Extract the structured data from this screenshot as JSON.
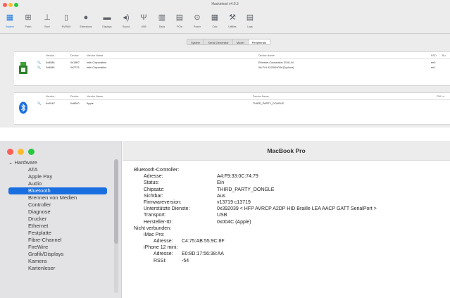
{
  "top_window": {
    "title": "Hackintool v4.0.3",
    "toolbar": [
      {
        "label": "System",
        "icon": "system-icon"
      },
      {
        "label": "Patch",
        "icon": "patch-icon"
      },
      {
        "label": "Boot",
        "icon": "boot-icon"
      },
      {
        "label": "NVRAM",
        "icon": "nvram-icon"
      },
      {
        "label": "Extensions",
        "icon": "extensions-icon"
      },
      {
        "label": "Displays",
        "icon": "displays-icon"
      },
      {
        "label": "Sound",
        "icon": "sound-icon"
      },
      {
        "label": "USB",
        "icon": "usb-icon"
      },
      {
        "label": "Disks",
        "icon": "disks-icon"
      },
      {
        "label": "PCIe",
        "icon": "pcie-icon"
      },
      {
        "label": "Power",
        "icon": "power-icon"
      },
      {
        "label": "Calc",
        "icon": "calc-icon"
      },
      {
        "label": "Utilities",
        "icon": "utilities-icon"
      },
      {
        "label": "Logs",
        "icon": "logs-icon"
      }
    ],
    "subtabs": [
      "System",
      "Serial Generator",
      "Model",
      "Peripherals"
    ],
    "network_table": {
      "headers": [
        "Vendor...",
        "Device",
        "Vendor Name",
        "Device Name",
        "BSD",
        "Bu"
      ],
      "rows": [
        {
          "vendor": "0x8086",
          "device": "0x15B7",
          "vendor_name": "Intel Corporation",
          "device_name": "Ethernet Connection I219-LM",
          "bsd": "en0"
        },
        {
          "vendor": "0x8086",
          "device": "0x2723",
          "vendor_name": "Intel Corporation",
          "device_name": "Wi-Fi 6 AX200NGW [Cyclone]",
          "bsd": "en1"
        }
      ]
    },
    "bluetooth_table": {
      "headers": [
        "Vendor...",
        "Device",
        "Vendor Name",
        "Device Name",
        "FW Lo"
      ],
      "rows": [
        {
          "vendor": "0x004C",
          "device": "0x8000",
          "vendor_name": "Apple",
          "device_name": "THIRD_PARTY_DONGLE"
        }
      ]
    }
  },
  "bottom_window": {
    "title": "MacBook Pro",
    "sidebar": {
      "header": "Hardware",
      "items": [
        "ATA",
        "Apple Pay",
        "Audio",
        "Bluetooth",
        "Brennen von Medien",
        "Controller",
        "Diagnose",
        "Drucker",
        "Ethernet",
        "Festplatte",
        "Fibre-Channel",
        "FireWire",
        "Grafik/Displays",
        "Kamera",
        "Kartenleser"
      ],
      "selected": "Bluetooth"
    },
    "details": [
      {
        "indent": 0,
        "key": "Bluetooth-Controller:",
        "value": ""
      },
      {
        "indent": 1,
        "key": "Adresse:",
        "value": "A4:F9:33:0C:74:79"
      },
      {
        "indent": 1,
        "key": "Status:",
        "value": "Ein"
      },
      {
        "indent": 1,
        "key": "Chipsatz:",
        "value": "THIRD_PARTY_DONGLE"
      },
      {
        "indent": 1,
        "key": "Sichtbar:",
        "value": "Aus"
      },
      {
        "indent": 1,
        "key": "Firmwareversion:",
        "value": "v13719 c13719"
      },
      {
        "indent": 1,
        "key": "Unterstützte Dienste:",
        "value": "0x392039 < HFP AVRCP A2DP HID Braille LEA AACP GATT SerialPort >"
      },
      {
        "indent": 1,
        "key": "Transport:",
        "value": "USB"
      },
      {
        "indent": 1,
        "key": "Hersteller-ID:",
        "value": "0x004C (Apple)"
      },
      {
        "indent": 0,
        "key": "Nicht verbunden:",
        "value": ""
      },
      {
        "indent": 1,
        "key": "iMac Pro:",
        "value": ""
      },
      {
        "indent": 2,
        "key": "Adresse:",
        "value": "C4:75:AB:55:9C:8F"
      },
      {
        "indent": 1,
        "key": "iPhone 12 mini:",
        "value": ""
      },
      {
        "indent": 2,
        "key": "Adresse:",
        "value": "E0:8D:17:56:38:AA"
      },
      {
        "indent": 2,
        "key": "RSSI:",
        "value": "-54"
      }
    ]
  }
}
